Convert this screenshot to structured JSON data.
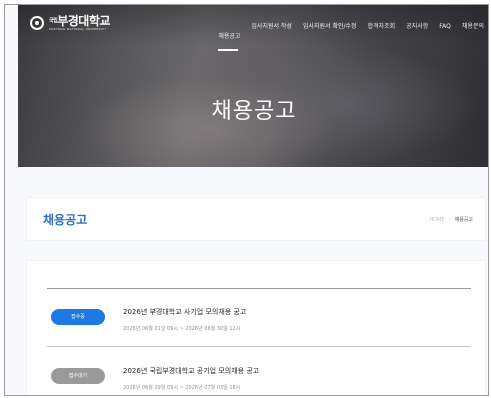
{
  "header": {
    "logo_name": "부경대학교",
    "logo_prefix": "국립",
    "logo_sub": "PUKYONG NATIONAL UNIVERSITY",
    "nav": [
      "채용공고",
      "입사지원서 작성",
      "입사지원서 확인/수정",
      "합격자조회",
      "공지사항",
      "FAQ",
      "채용문의"
    ]
  },
  "hero": {
    "title": "채용공고"
  },
  "breadcrumb": {
    "title": "채용공고",
    "home": "HOME",
    "separator": "›",
    "current": "채용공고"
  },
  "listings": [
    {
      "status": "접수중",
      "title": "2026년 부경대학교 사기업 모의채용 공고",
      "period": "2026년 06월 01일 09시 ~ 2026년 06월 30일 11시"
    },
    {
      "status": "접수대기",
      "title": "2026년 국립부경대학교 공기업 모의채용 공고",
      "period": "2026년 06월 29일 09시 ~ 2026년 07월 03일 18시"
    }
  ],
  "colors": {
    "accent": "#1f79e5",
    "title_blue": "#2a6fc8",
    "pending": "#9a9a9a"
  }
}
